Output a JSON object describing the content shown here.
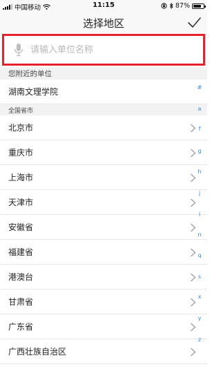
{
  "status_bar": {
    "carrier": "中国移动",
    "time": "11:15",
    "battery_percent": "87%",
    "battery_level": 0.87,
    "icons": [
      "signal-icon",
      "wifi-icon",
      "lock-rotation-icon",
      "bluetooth-icon",
      "battery-icon"
    ]
  },
  "nav": {
    "title": "选择地区",
    "confirm_icon": "checkmark-icon"
  },
  "search": {
    "placeholder": "请输入单位名称",
    "value": "",
    "icon": "microphone-icon",
    "highlight_color": "#e8202a"
  },
  "nearby": {
    "header": "您附近的单位",
    "items": [
      {
        "label": "湖南文理学院"
      }
    ]
  },
  "national": {
    "header": "全国省市",
    "items": [
      {
        "label": "北京市"
      },
      {
        "label": "重庆市"
      },
      {
        "label": "上海市"
      },
      {
        "label": "天津市"
      },
      {
        "label": "安徽省"
      },
      {
        "label": "福建省"
      },
      {
        "label": "港澳台"
      },
      {
        "label": "甘肃省"
      },
      {
        "label": "广东省"
      },
      {
        "label": "广西壮族自治区"
      }
    ]
  },
  "index_letters": [
    "#",
    "a",
    "f",
    "g",
    "h",
    "j",
    "l",
    "n",
    "q",
    "s",
    "x",
    "y",
    "z"
  ],
  "colors": {
    "accent": "#2a8ae8",
    "section_bg": "#f2f2f2",
    "bar_bg": "#f8f8f8"
  }
}
